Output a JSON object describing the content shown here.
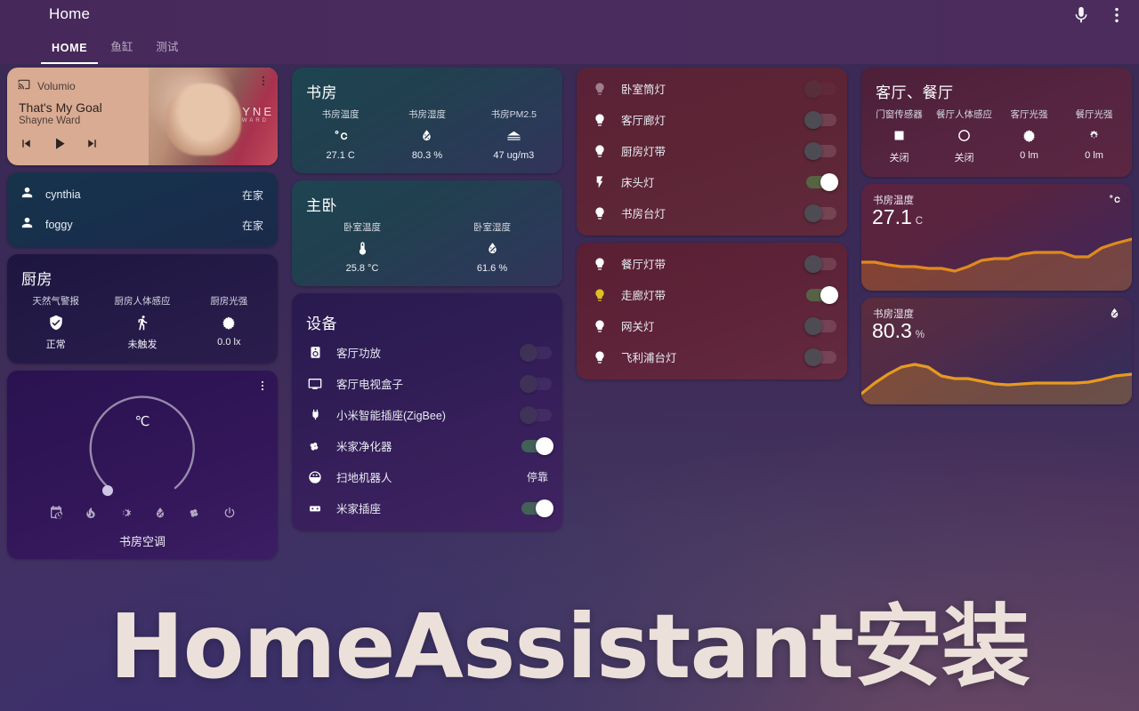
{
  "header": {
    "title": "Home",
    "mic_icon": "microphone-icon",
    "overflow_icon": "more-vertical-icon",
    "tabs": [
      {
        "label": "HOME",
        "active": true
      },
      {
        "label": "鱼缸",
        "active": false
      },
      {
        "label": "测试",
        "active": false
      }
    ]
  },
  "media_player": {
    "source": "Volumio",
    "source_icon": "cast-icon",
    "title": "That's My Goal",
    "artist": "Shayne Ward",
    "album_art_text": "SHAYNE",
    "album_art_subtext": "WARD",
    "controls": {
      "prev": "skip-previous-icon",
      "play": "play-icon",
      "next": "skip-next-icon"
    },
    "menu_icon": "more-vertical-icon"
  },
  "persons": {
    "rows": [
      {
        "icon": "person-icon",
        "name": "cynthia",
        "state": "在家"
      },
      {
        "icon": "person-icon",
        "name": "foggy",
        "state": "在家"
      }
    ]
  },
  "kitchen": {
    "title": "厨房",
    "sensors": [
      {
        "label": "天然气警报",
        "icon": "shield-check-icon",
        "value": "正常"
      },
      {
        "label": "厨房人体感应",
        "icon": "motion-walk-icon",
        "value": "未触发"
      },
      {
        "label": "厨房光强",
        "icon": "brightness-icon",
        "value": "0.0 lx"
      }
    ]
  },
  "thermostat": {
    "unit": "℃",
    "name": "书房空调",
    "menu_icon": "more-vertical-icon",
    "modes": [
      {
        "icon": "calendar-clock-icon",
        "name": "auto-mode"
      },
      {
        "icon": "fire-icon",
        "name": "heat-mode"
      },
      {
        "icon": "snowflake-icon",
        "name": "cool-mode"
      },
      {
        "icon": "water-percent-icon",
        "name": "dry-mode"
      },
      {
        "icon": "fan-icon",
        "name": "fan-mode"
      },
      {
        "icon": "power-icon",
        "name": "off-mode"
      }
    ]
  },
  "study": {
    "title": "书房",
    "sensors": [
      {
        "label": "书房温度",
        "icon": "celsius-icon",
        "value": "27.1 C"
      },
      {
        "label": "书房湿度",
        "icon": "water-drop-icon",
        "value": "80.3 %"
      },
      {
        "label": "书房PM2.5",
        "icon": "air-filter-icon",
        "value": "47 ug/m3"
      }
    ]
  },
  "bedroom": {
    "title": "主卧",
    "sensors": [
      {
        "label": "卧室温度",
        "icon": "thermometer-icon",
        "value": "25.8 °C"
      },
      {
        "label": "卧室湿度",
        "icon": "water-drop-icon",
        "value": "61.6 %"
      }
    ]
  },
  "devices": {
    "title": "设备",
    "rows": [
      {
        "icon": "speaker-icon",
        "name": "客厅功放",
        "control": "toggle",
        "on": false
      },
      {
        "icon": "television-icon",
        "name": "客厅电视盒子",
        "control": "toggle",
        "on": false
      },
      {
        "icon": "power-plug-icon",
        "name": "小米智能插座(ZigBee)",
        "control": "toggle",
        "on": false
      },
      {
        "icon": "fan-icon",
        "name": "米家净化器",
        "control": "toggle",
        "on": true
      },
      {
        "icon": "robot-vacuum-icon",
        "name": "扫地机器人",
        "control": "state",
        "state": "停靠"
      },
      {
        "icon": "power-socket-icon",
        "name": "米家插座",
        "control": "toggle",
        "on": true
      }
    ]
  },
  "lights_primary": {
    "rows": [
      {
        "icon": "lightbulb-icon",
        "name": "卧室筒灯",
        "on": false,
        "unavailable": true
      },
      {
        "icon": "lightbulb-icon",
        "name": "客厅廊灯",
        "on": false,
        "unavailable": false
      },
      {
        "icon": "lightbulb-icon",
        "name": "厨房灯带",
        "on": false,
        "unavailable": false
      },
      {
        "icon": "flash-icon",
        "name": "床头灯",
        "on": true,
        "unavailable": false
      },
      {
        "icon": "lightbulb-icon",
        "name": "书房台灯",
        "on": false,
        "unavailable": false
      }
    ]
  },
  "lights_secondary": {
    "rows": [
      {
        "icon": "lightbulb-icon",
        "name": "餐厅灯带",
        "on": false,
        "unavailable": false
      },
      {
        "icon": "lightbulb-icon",
        "name": "走廊灯带",
        "on": true,
        "unavailable": false
      },
      {
        "icon": "lightbulb-icon",
        "name": "网关灯",
        "on": false,
        "unavailable": false
      },
      {
        "icon": "lightbulb-icon",
        "name": "飞利浦台灯",
        "on": false,
        "unavailable": false
      }
    ]
  },
  "living_dining": {
    "title": "客厅、餐厅",
    "sensors": [
      {
        "label": "门窗传感器",
        "icon": "window-closed-icon",
        "value": "关闭"
      },
      {
        "label": "餐厅人体感应",
        "icon": "circle-outline-icon",
        "value": "关闭"
      },
      {
        "label": "客厅光强",
        "icon": "brightness-icon",
        "value": "0 lm"
      },
      {
        "label": "餐厅光强",
        "icon": "brightness-low-icon",
        "value": "0 lm"
      }
    ]
  },
  "graphs": [
    {
      "name": "书房温度",
      "value": "27.1",
      "unit": "C",
      "icon": "celsius-icon",
      "line_color": "#e08a1e",
      "chart_data": {
        "type": "line",
        "title": "书房温度",
        "ylabel": "C",
        "points": [
          26.4,
          26.4,
          26.2,
          26.1,
          26.1,
          26.0,
          26.0,
          25.9,
          26.1,
          26.4,
          26.5,
          26.5,
          26.7,
          26.8,
          26.8,
          26.8,
          26.6,
          26.6,
          26.9,
          27.0,
          27.1
        ]
      }
    },
    {
      "name": "书房湿度",
      "value": "80.3",
      "unit": "%",
      "icon": "water-drop-icon",
      "line_color": "#e69a20",
      "chart_data": {
        "type": "line",
        "title": "书房湿度",
        "ylabel": "%",
        "points": [
          72.0,
          76.0,
          79.5,
          81.5,
          82.0,
          80.5,
          78.5,
          78.3,
          78.2,
          77.8,
          77.2,
          77.0,
          77.1,
          77.4,
          77.5,
          77.5,
          77.5,
          77.6,
          78.2,
          79.4,
          80.3
        ]
      }
    }
  ],
  "overlay": {
    "title": "HomeAssistant安装"
  }
}
